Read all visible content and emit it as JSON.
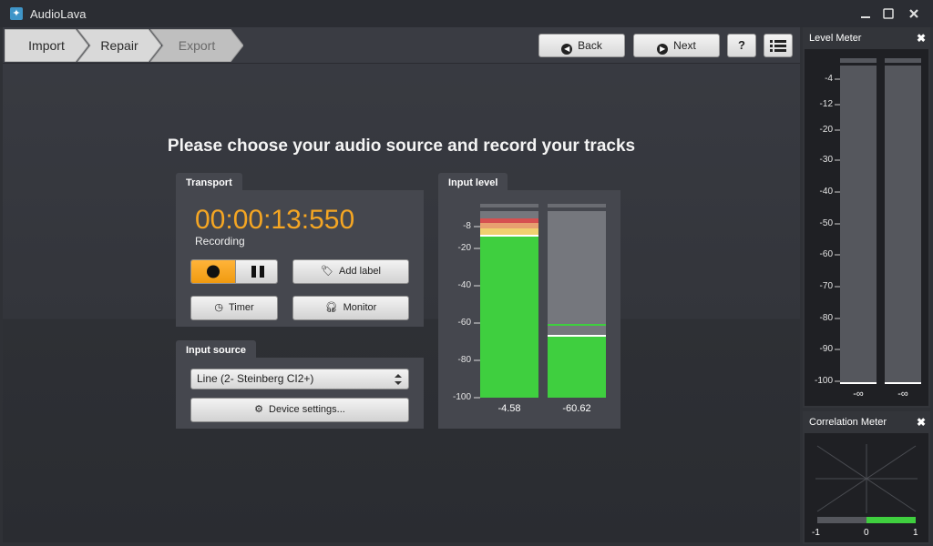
{
  "app": {
    "title": "AudioLava",
    "icon": "sparkle-icon"
  },
  "window_controls": {
    "minimize": "—",
    "maximize": "☐",
    "close": "✖"
  },
  "breadcrumbs": [
    {
      "label": "Import",
      "state": "done"
    },
    {
      "label": "Repair",
      "state": "done"
    },
    {
      "label": "Export",
      "state": "pending"
    }
  ],
  "toolbar": {
    "back_label": "Back",
    "next_label": "Next",
    "help_label": "?",
    "menu_icon": "list-icon"
  },
  "heading": "Please choose your audio source and record your tracks",
  "transport": {
    "tab_label": "Transport",
    "time": "00:00:13:550",
    "status": "Recording",
    "add_label": "Add label",
    "timer_label": "Timer",
    "monitor_label": "Monitor",
    "record_active": true
  },
  "input_source": {
    "tab_label": "Input source",
    "selected": "Line (2- Steinberg CI2+)",
    "device_settings_label": "Device settings..."
  },
  "input_level": {
    "tab_label": "Input level",
    "scale": [
      "-8",
      "-20",
      "-40",
      "-60",
      "-80",
      "-100"
    ],
    "channels": [
      {
        "readout": "-4.58"
      },
      {
        "readout": "-60.62"
      }
    ]
  },
  "level_meter": {
    "title": "Level Meter",
    "close": "✖",
    "scale": [
      "-4",
      "-12",
      "-20",
      "-30",
      "-40",
      "-50",
      "-60",
      "-70",
      "-80",
      "-90",
      "-100"
    ],
    "readouts": [
      "-∞",
      "-∞"
    ]
  },
  "correlation_meter": {
    "title": "Correlation Meter",
    "close": "✖",
    "axis": [
      "-1",
      "0",
      "1"
    ],
    "value": 1
  },
  "colors": {
    "accent": "#f5a623",
    "meter_green": "#3fcf3f",
    "panel": "#45474e"
  }
}
